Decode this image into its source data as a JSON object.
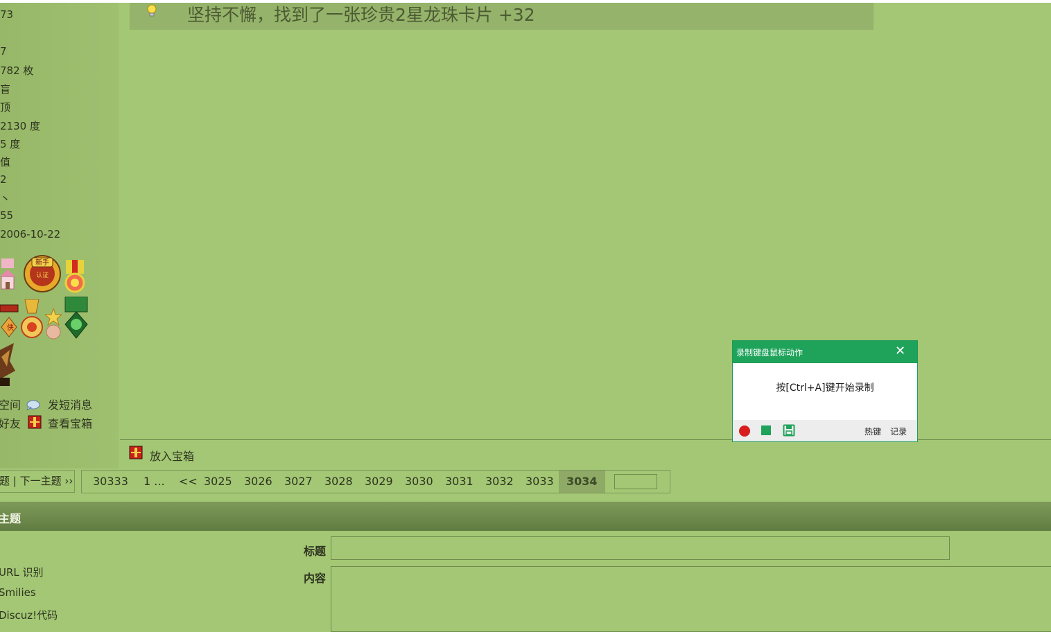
{
  "sidebar": {
    "stats": [
      "73",
      "7",
      "782 枚",
      "盲",
      "顶",
      "2130 度",
      "5 度",
      "值",
      "2",
      "丶",
      " 55",
      " 2006-10-22"
    ],
    "medal_names": [
      "pink-house-medal",
      "newbie-badge-medal",
      "sun-ribbon-medal",
      "star-ribbon-medal",
      "gold-medal",
      "star-medal",
      "green-crest-medal",
      "phoenix-medal"
    ],
    "links": [
      {
        "label": "空间",
        "icon": "home-icon"
      },
      {
        "label": "发短消息",
        "icon": "message-icon"
      },
      {
        "label": "好友",
        "icon": "friend-icon"
      },
      {
        "label": "查看宝箱",
        "icon": "treasure-chest-icon"
      }
    ]
  },
  "notice": {
    "text": "坚持不懈，找到了一张珍贵2星龙珠卡片 +32",
    "icon": "lightbulb-icon"
  },
  "actions": {
    "put_treasure": "放入宝箱"
  },
  "nav": {
    "prev_next": "题 | 下一主题 ››"
  },
  "pager": {
    "total": "30333",
    "first": "1 ...",
    "prev": "<<",
    "pages": [
      "3025",
      "3026",
      "3027",
      "3028",
      "3029",
      "3030",
      "3031",
      "3032",
      "3033"
    ],
    "current": "3034"
  },
  "reply": {
    "section_title": "主题",
    "title_label": "标题",
    "content_label": "内容",
    "options": [
      "URL 识别",
      "Smilies",
      "Discuz!代码"
    ]
  },
  "dialog": {
    "title": "录制键盘鼠标动作",
    "close": "✕",
    "message": "按[Ctrl+A]键开始录制",
    "hotkey": "热键",
    "log": "记录"
  },
  "colors": {
    "page_bg": "#a3c774",
    "dialog_green": "#1fa35b",
    "record_red": "#d81e1e"
  }
}
